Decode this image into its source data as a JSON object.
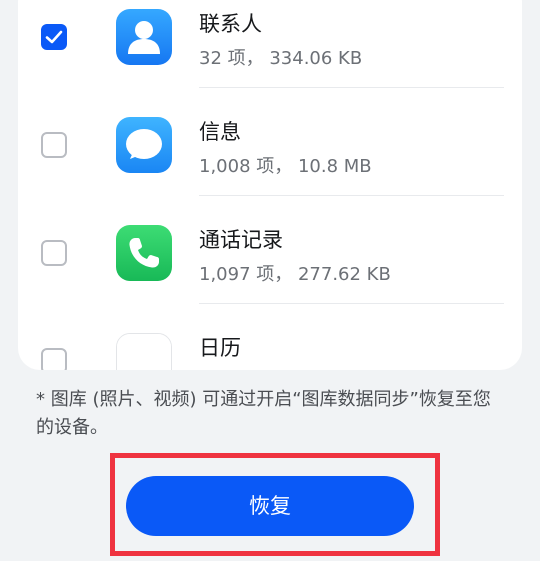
{
  "items": [
    {
      "title": "联系人",
      "subtitle": "32 项， 334.06 KB",
      "checked": true,
      "icon": "contacts-icon"
    },
    {
      "title": "信息",
      "subtitle": "1,008 项， 10.8 MB",
      "checked": false,
      "icon": "messages-icon"
    },
    {
      "title": "通话记录",
      "subtitle": "1,097 项， 277.62 KB",
      "checked": false,
      "icon": "phone-icon"
    },
    {
      "title": "日历",
      "subtitle": "",
      "checked": false,
      "icon": "calendar-icon"
    }
  ],
  "note": "* 图库 (照片、视频) 可通过开启“图库数据同步”恢复至您的设备。",
  "restore_label": "恢复",
  "colors": {
    "accent": "#0a59f7",
    "highlight": "#ef3340",
    "background": "#f1f3f5"
  }
}
